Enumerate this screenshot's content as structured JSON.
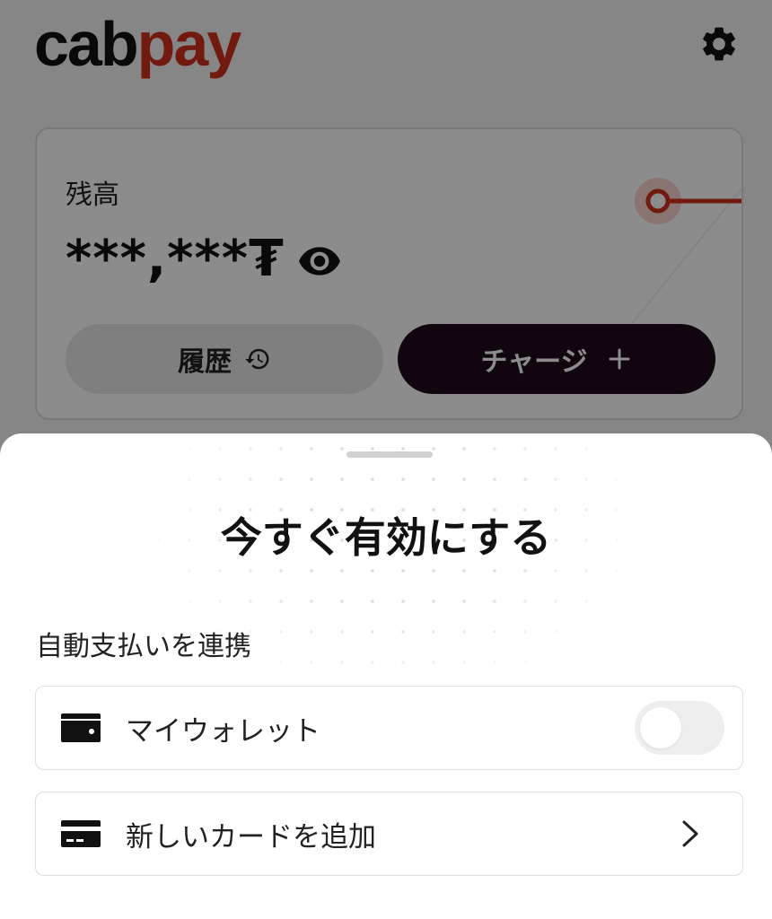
{
  "app": {
    "logo_part1": "cab",
    "logo_part2": "pay",
    "brand_color": "#d0301c",
    "settings_icon": "gear-icon"
  },
  "balance_card": {
    "label": "残高",
    "value": "***,***₮",
    "visibility_icon": "eye-icon",
    "history_label": "履歴",
    "history_icon": "history-clock-icon",
    "charge_label": "チャージ",
    "charge_icon": "plus-icon"
  },
  "sheet": {
    "title": "今すぐ有効にする",
    "section_label": "自動支払いを連携",
    "options": [
      {
        "label": "マイウォレット",
        "icon": "wallet-icon",
        "control": "toggle",
        "enabled": false
      },
      {
        "label": "新しいカードを追加",
        "icon": "credit-card-icon",
        "control": "chevron-right-icon"
      }
    ]
  },
  "colors": {
    "charge_button": "#1f0b1c",
    "overlay": "rgba(0,0,0,0.45)"
  }
}
